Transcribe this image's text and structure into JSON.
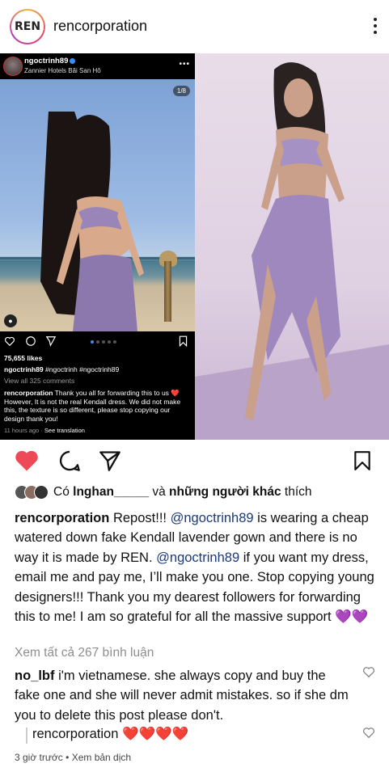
{
  "header": {
    "avatar_text": "REN",
    "username": "rencorporation"
  },
  "embedded_post": {
    "username": "ngoctrinh89",
    "location": "Zannier Hotels Bãi San Hô",
    "counter": "1/8",
    "likes": "75,655 likes",
    "caption_user": "ngoctrinh89",
    "caption_text": "#ngoctrinh #ngoctrinh89",
    "view_comments": "View all 325 comments",
    "comment_user": "rencorporation",
    "comment_text": "Thank you all for forwarding this to us ❤️ However, It is not the real Kendall dress. We did not make this, the texture is so different, please stop copying our design thank you!",
    "time": "11 hours ago",
    "see_translation": "See translation"
  },
  "likes": {
    "prefix": "Có",
    "user": "lnghan_____",
    "middle": "và",
    "others": "những người khác",
    "suffix": "thích"
  },
  "caption": {
    "user": "rencorporation",
    "part1": "Repost!!!",
    "mention1": "@ngoctrinh89",
    "part2": "is wearing a cheap watered down fake Kendall lavender gown and there is no way it is made by REN.",
    "mention2": "@ngoctrinh89",
    "part3": "if you want my dress, email me and pay me, I’ll make you one. Stop copying young designers!!! Thank you my dearest followers for forwarding this to me! I am so grateful for all the massive support 💜💜"
  },
  "view_all_comments": "Xem tất cả 267 bình luận",
  "comments": [
    {
      "user": "no_lbf",
      "text": "i'm vietnamese. she always copy and buy the fake one and she will never admit mistakes. so if she dm you to delete this post please don't."
    }
  ],
  "reply": {
    "user": "rencorporation",
    "text": "❤️❤️❤️❤️"
  },
  "footer": {
    "time": "3 giờ trước",
    "separator": "•",
    "translate": "Xem bản dịch"
  },
  "colors": {
    "like_red": "#ed4956",
    "mention_blue": "#1a3a7a",
    "muted": "#8e8e8e"
  }
}
